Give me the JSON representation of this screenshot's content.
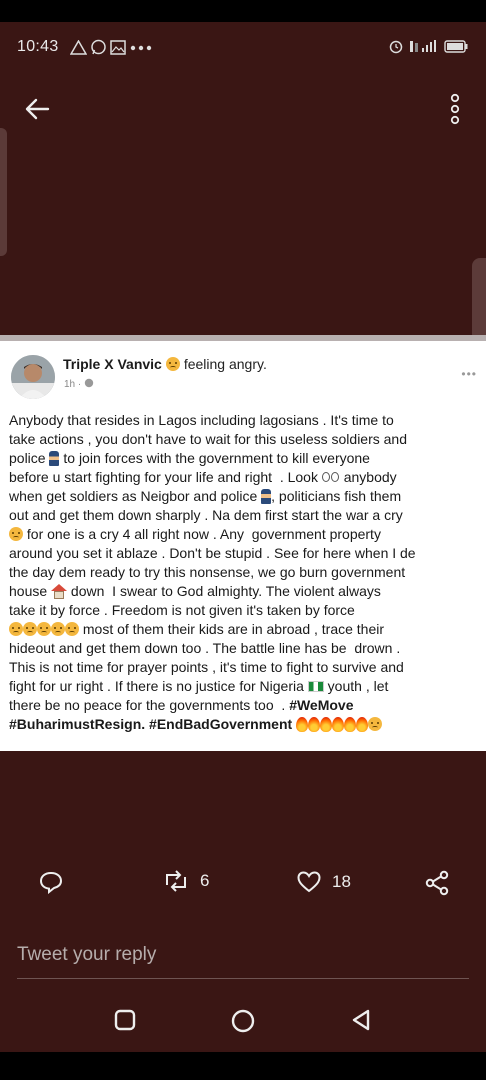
{
  "status_bar": {
    "time": "10:43",
    "left_icons": [
      "warning-icon",
      "whatsapp-icon",
      "gallery-icon",
      "more-dots-icon"
    ],
    "right_icons": [
      "alarm-icon",
      "signal-icon",
      "battery-icon"
    ]
  },
  "header": {
    "back_icon": "arrow-left-icon",
    "more_icon": "vertical-dots-icon"
  },
  "post": {
    "author": "Triple X Vanvic",
    "feeling": "feeling angry.",
    "meta": "1h · ",
    "lines": [
      "Anybody that resides in Lagos including lagosians . It's time to",
      "take actions , you don't have to wait for this useless soldiers and",
      "police",
      " to join forces with the government to kill everyone",
      "before u start fighting for your life and right  . Look",
      " anybody",
      "when get soldiers as Neigbor and police",
      ", politicians fish them",
      "out and get them down sharply . Na dem first start the war a cry",
      " for one is a cry 4 all right now . Any  government property",
      "around you set it ablaze . Don't be stupid . See for here when I de",
      "the day dem ready to try this nonsense, we go burn government",
      "house",
      " down  I swear to God almighty. The violent always",
      "take it by force . Freedom is not given it's taken by force",
      " most of them their kids are in abroad , trace their",
      "hideout and get them down too . The battle line has be  drown .",
      "This is not time for prayer points , it's time to fight to survive and",
      "fight for ur right . If there is no justice for Nigeria",
      " youth , let",
      "there be no peace for the governments too  . ",
      "#WeMove",
      "#BuharimustResign. #EndBadGovernment"
    ]
  },
  "actions": {
    "comment_icon": "comment-icon",
    "retweet_icon": "retweet-icon",
    "retweet_count": "6",
    "like_icon": "heart-icon",
    "like_count": "18",
    "share_icon": "share-icon"
  },
  "reply": {
    "placeholder": "Tweet your reply"
  },
  "nav": {
    "recents_icon": "square-icon",
    "home_icon": "circle-icon",
    "back_icon": "triangle-back-icon"
  },
  "colors": {
    "background": "#3a1614",
    "card": "#ffffff",
    "text": "#1a1a1a"
  }
}
